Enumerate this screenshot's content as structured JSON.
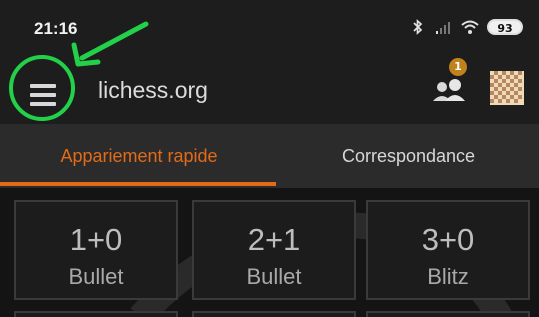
{
  "status_bar": {
    "time": "21:16",
    "battery": "93"
  },
  "header": {
    "site_name": "lichess.org",
    "notification_count": "1"
  },
  "tabs": [
    {
      "label": "Appariement rapide",
      "active": true
    },
    {
      "label": "Correspondance",
      "active": false
    }
  ],
  "pairings": [
    {
      "clock": "1+0",
      "type": "Bullet"
    },
    {
      "clock": "2+1",
      "type": "Bullet"
    },
    {
      "clock": "3+0",
      "type": "Blitz"
    }
  ],
  "colors": {
    "accent": "#e36b18",
    "annotation": "#22d04a",
    "badge": "#c0821a"
  },
  "icons": {
    "menu": "hamburger-menu-icon",
    "players": "people-icon",
    "board": "chessboard-icon"
  }
}
